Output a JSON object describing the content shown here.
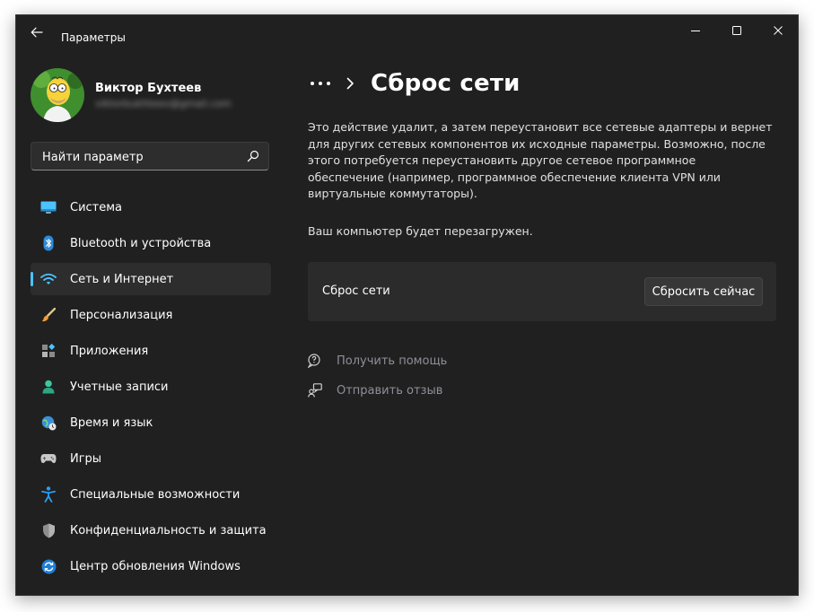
{
  "window": {
    "title": "Параметры"
  },
  "profile": {
    "name": "Виктор Бухтеев",
    "email": "viktorbukhteev@gmail.com"
  },
  "search": {
    "placeholder": "Найти параметр"
  },
  "sidebar": {
    "items": [
      {
        "label": "Система",
        "icon": "display-icon"
      },
      {
        "label": "Bluetooth и устройства",
        "icon": "bluetooth-icon"
      },
      {
        "label": "Сеть и Интернет",
        "icon": "wifi-icon",
        "active": true
      },
      {
        "label": "Персонализация",
        "icon": "brush-icon"
      },
      {
        "label": "Приложения",
        "icon": "apps-icon"
      },
      {
        "label": "Учетные записи",
        "icon": "account-icon"
      },
      {
        "label": "Время и язык",
        "icon": "globe-clock-icon"
      },
      {
        "label": "Игры",
        "icon": "gamepad-icon"
      },
      {
        "label": "Специальные возможности",
        "icon": "accessibility-icon"
      },
      {
        "label": "Конфиденциальность и защита",
        "icon": "shield-icon"
      },
      {
        "label": "Центр обновления Windows",
        "icon": "update-icon"
      }
    ]
  },
  "main": {
    "title": "Сброс сети",
    "description": "Это действие удалит, а затем переустановит все сетевые адаптеры и вернет для других сетевых компонентов их исходные параметры. Возможно, после этого потребуется переустановить другое сетевое программное обеспечение (например, программное обеспечение клиента VPN или виртуальные коммутаторы).",
    "reboot_note": "Ваш компьютер будет перезагружен.",
    "card": {
      "label": "Сброс сети",
      "button_label": "Сбросить сейчас"
    },
    "links": {
      "help": "Получить помощь",
      "feedback": "Отправить отзыв"
    }
  },
  "colors": {
    "background": "#202020",
    "accent": "#4cc2ff",
    "card": "#2b2b2b",
    "link": "#8f8f98"
  }
}
